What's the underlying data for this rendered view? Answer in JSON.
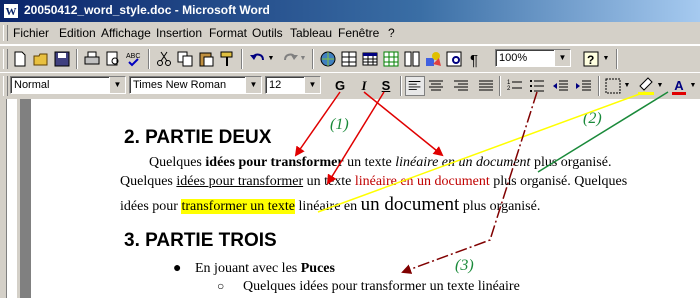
{
  "window": {
    "title": "20050412_word_style.doc - Microsoft Word"
  },
  "menu": [
    "Fichier",
    "Edition",
    "Affichage",
    "Insertion",
    "Format",
    "Outils",
    "Tableau",
    "Fenêtre",
    "?"
  ],
  "standard_toolbar": {
    "zoom": "100%"
  },
  "formatting_toolbar": {
    "style": "Normal",
    "font": "Times New Roman",
    "size": "12",
    "bold": "G",
    "italic": "I",
    "underline": "S",
    "font_color_letter": "A"
  },
  "document": {
    "section2_heading": "2. PARTIE DEUX",
    "p1": {
      "a": "Quelques ",
      "b": "idées pour transformer",
      "c": " un texte ",
      "d": "linéaire en un document",
      "e": " plus organisé."
    },
    "p2": {
      "a": "Quelques ",
      "b": "idées pour transformer",
      "c": " un texte ",
      "d": "linéaire en un document",
      "e": " plus organisé. Quelques"
    },
    "p3": {
      "a": "idées pour ",
      "b": "transformer un texte",
      "c": " linéaire en ",
      "d": "un document",
      "e": " plus organisé."
    },
    "section3_heading": "3. PARTIE TROIS",
    "bullet1": {
      "a": "En jouant avec les ",
      "b": "Puces"
    },
    "bullet2": "Quelques idées pour transformer un texte linéaire"
  },
  "annotations": [
    "(1)",
    "(2)",
    "(3)"
  ],
  "colors": {
    "title_bar": "#0a246a",
    "red_text": "#c00000",
    "highlight": "#ffff00",
    "annotation_green": "#1a8a3a",
    "arrow_red": "#e00000",
    "arrow_yellow": "#ffff00",
    "arrow_brown": "#800000"
  }
}
